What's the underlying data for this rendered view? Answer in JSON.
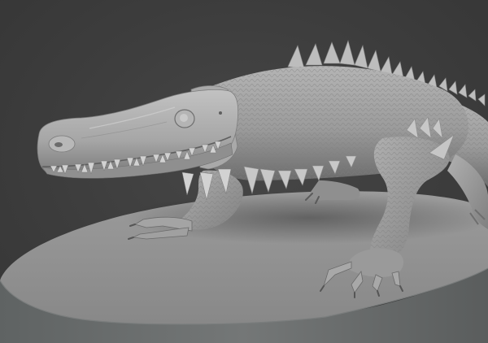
{
  "viewport": {
    "background_color": "#3d3d3d",
    "clay_color": "#9a9a9a",
    "base_top_color": "#8e8e8e",
    "base_side_color": "#6f7272"
  },
  "model": {
    "subject": "crocodile-sculpt-on-oval-base"
  }
}
